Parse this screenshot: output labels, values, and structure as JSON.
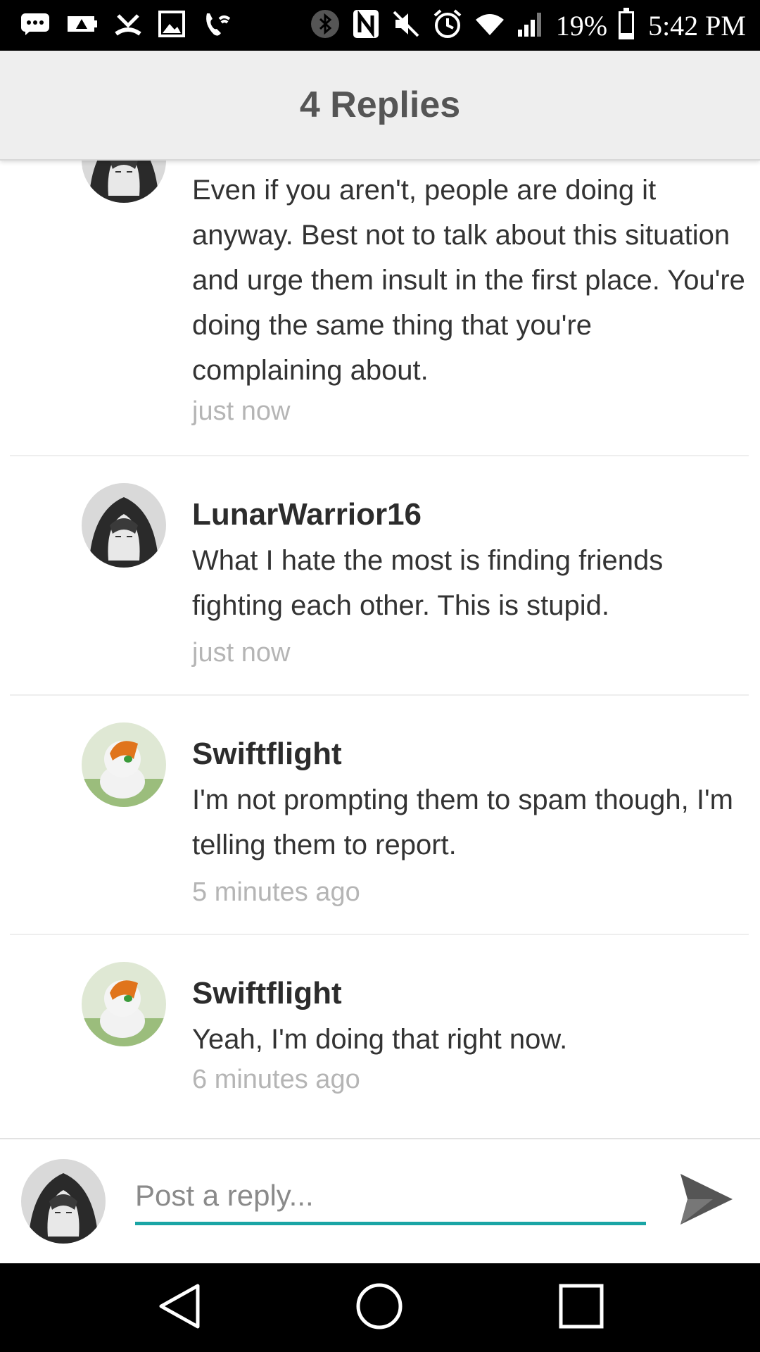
{
  "status_bar": {
    "battery_percent": "19%",
    "battery_level": 0.19,
    "time": "5:42 PM",
    "icons_left": [
      "message-icon",
      "battery-saver-icon",
      "missed-call-icon",
      "image-icon",
      "wifi-call-icon"
    ],
    "icons_right": [
      "bluetooth-icon",
      "nfc-icon",
      "mute-icon",
      "alarm-icon",
      "wifi-icon",
      "signal-icon"
    ]
  },
  "header": {
    "title": "4 Replies"
  },
  "replies": [
    {
      "username": "",
      "body": "Even if you aren't, people are doing it anyway. Best not to talk about this situation and urge them insult in the first place. You're doing the same thing that you're complaining about.",
      "time": "just now",
      "avatar": "hooded-avatar"
    },
    {
      "username": "LunarWarrior16",
      "body": "What I hate the most is finding friends fighting each other. This is stupid.",
      "time": "just now",
      "avatar": "hooded-avatar"
    },
    {
      "username": "Swiftflight",
      "body": "I'm not prompting them to spam though, I'm telling them to report.",
      "time": "5 minutes ago",
      "avatar": "cat-avatar"
    },
    {
      "username": "Swiftflight",
      "body": "Yeah, I'm doing that right now.",
      "time": "6 minutes ago",
      "avatar": "cat-avatar"
    }
  ],
  "reply_bar": {
    "placeholder": "Post a reply...",
    "value": "",
    "accent_color": "#1aa5a5",
    "send_icon": "send-icon"
  },
  "nav_bar": {
    "buttons": [
      "back-icon",
      "home-icon",
      "recents-icon"
    ]
  }
}
